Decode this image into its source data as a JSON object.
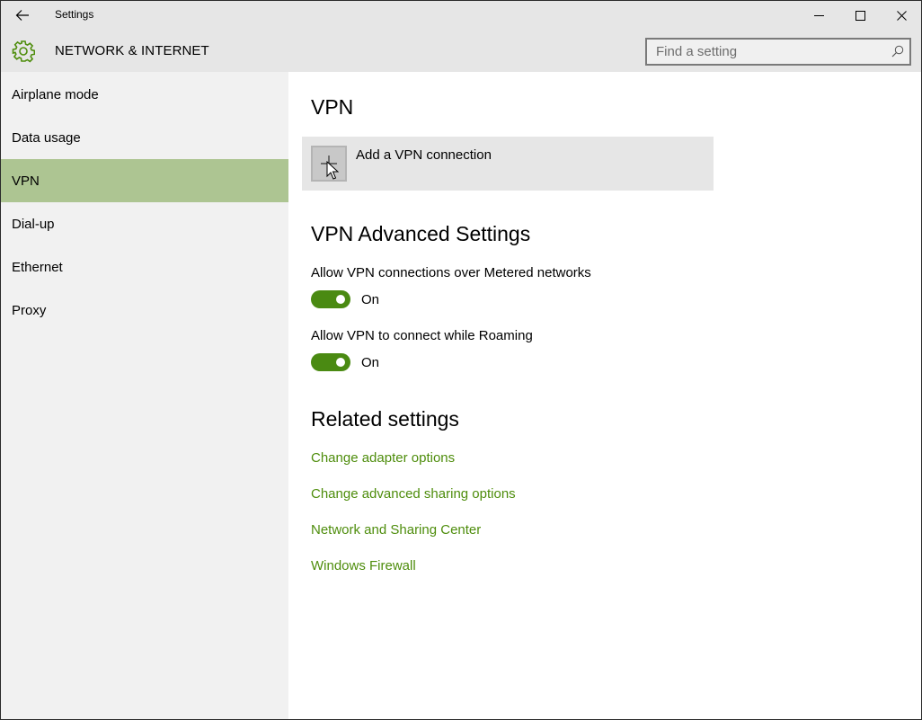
{
  "window": {
    "app_title": "Settings",
    "controls": {
      "minimize": "minimize",
      "maximize": "maximize",
      "close": "close"
    }
  },
  "header": {
    "section_title": "NETWORK & INTERNET",
    "search": {
      "placeholder": "Find a setting",
      "value": ""
    }
  },
  "sidebar": {
    "items": [
      {
        "label": "Airplane mode",
        "active": false
      },
      {
        "label": "Data usage",
        "active": false
      },
      {
        "label": "VPN",
        "active": true
      },
      {
        "label": "Dial-up",
        "active": false
      },
      {
        "label": "Ethernet",
        "active": false
      },
      {
        "label": "Proxy",
        "active": false
      }
    ]
  },
  "main": {
    "title": "VPN",
    "add_connection_label": "Add a VPN connection",
    "advanced": {
      "title": "VPN Advanced Settings",
      "settings": [
        {
          "label": "Allow VPN connections over Metered networks",
          "state": "On",
          "on": true
        },
        {
          "label": "Allow VPN to connect while Roaming",
          "state": "On",
          "on": true
        }
      ]
    },
    "related": {
      "title": "Related settings",
      "links": [
        "Change adapter options",
        "Change advanced sharing options",
        "Network and Sharing Center",
        "Windows Firewall"
      ]
    }
  },
  "colors": {
    "accent": "#4a8a12",
    "link": "#4e8d0c",
    "nav_active": "#adc592",
    "header_bg": "#e6e6e6",
    "sidebar_bg": "#f1f1f1"
  }
}
